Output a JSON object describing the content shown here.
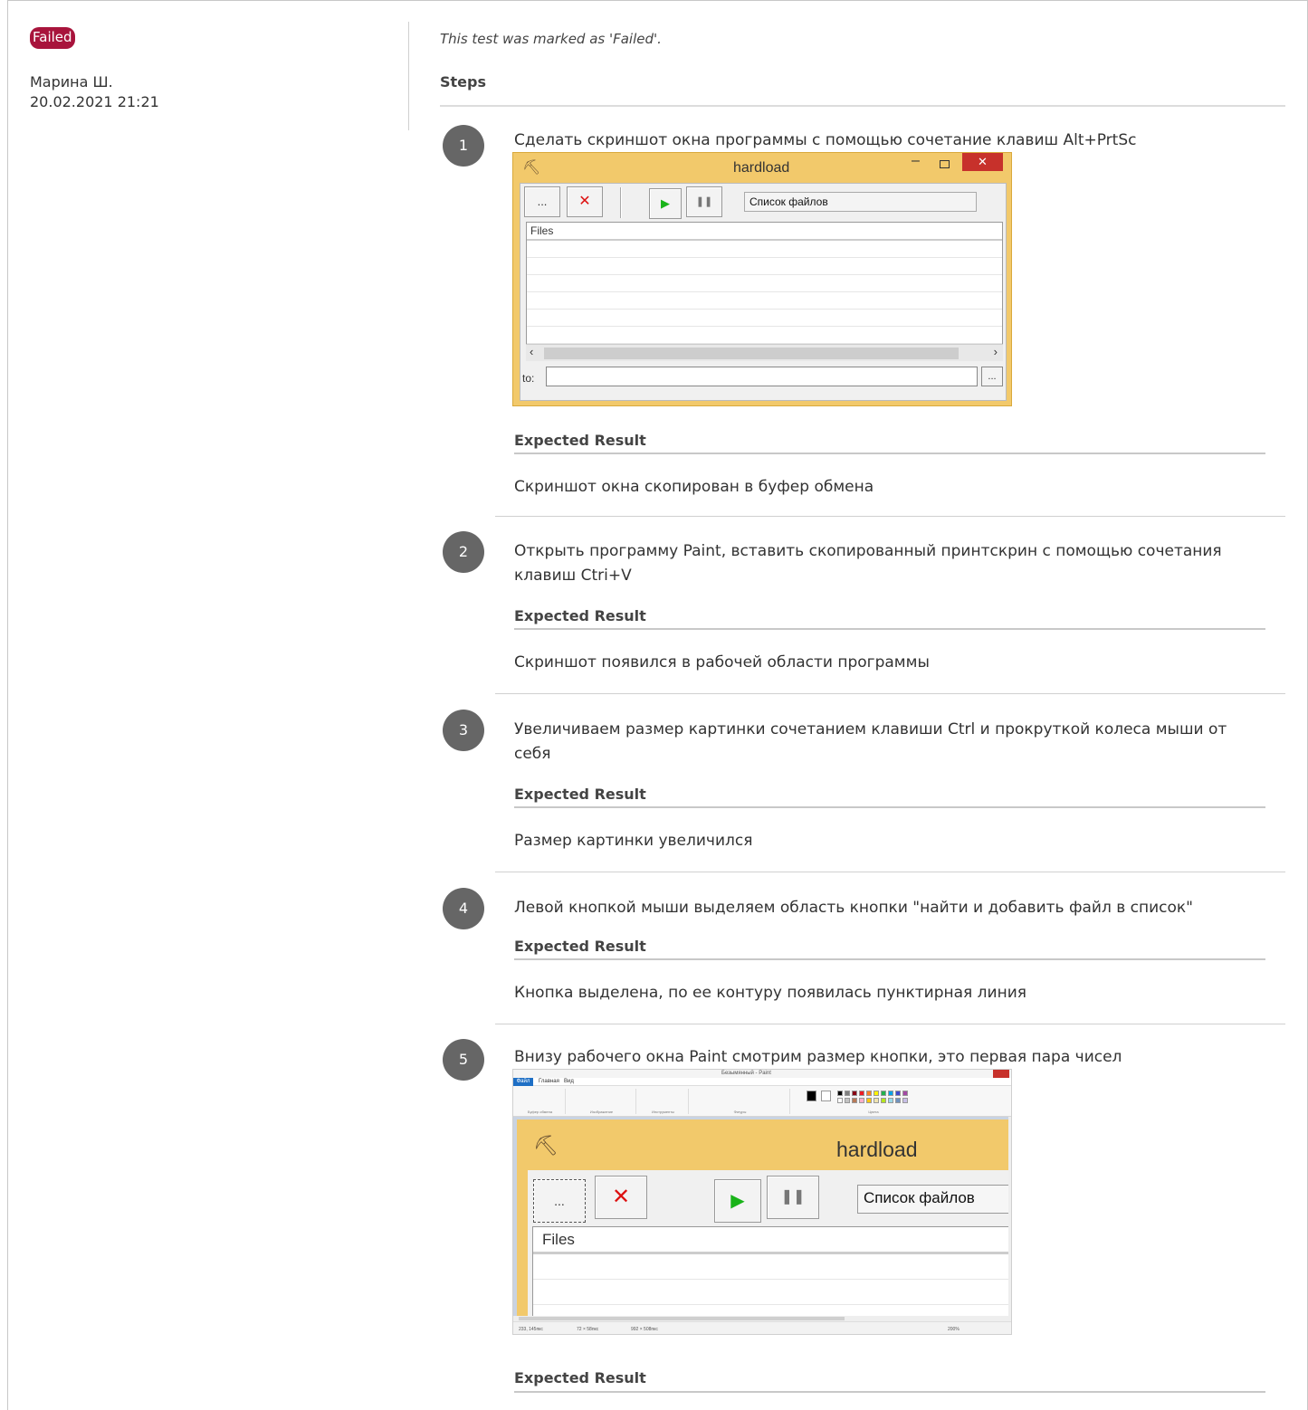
{
  "status_badge": "Failed",
  "author": "Марина Ш.",
  "timestamp": "20.02.2021 21:21",
  "marked_text": "This test was marked as 'Failed'.",
  "steps_heading": "Steps",
  "expected_label": "Expected Result",
  "steps": [
    {
      "number": "1",
      "text": "Сделать скриншот окна программы с помощью сочетание клавиш Alt+PrtSc",
      "expected": "Скриншот окна скопирован в буфер обмена"
    },
    {
      "number": "2",
      "text": "Открыть программу Paint, вставить скопированный принтскрин с помощью сочетания клавиш Ctri+V",
      "expected": "Скриншот появился в рабочей области программы"
    },
    {
      "number": "3",
      "text": "Увеличиваем размер картинки сочетанием клавиши Ctrl и прокруткой колеса мыши от себя",
      "expected": "Размер картинки увеличился"
    },
    {
      "number": "4",
      "text": "Левой кнопкой мыши выделяем область кнопки \"найти и добавить файл в список\"",
      "expected": "Кнопка выделена, по ее контуру появилась пунктирная линия"
    },
    {
      "number": "5",
      "text": "Внизу рабочего окна Paint смотрим размер кнопки, это первая пара чисел",
      "expected": ""
    }
  ],
  "hardload": {
    "title": "hardload",
    "browse_label": "...",
    "list_label": "Список файлов",
    "files_header": "Files",
    "to_label": "to:",
    "to_browse": "...",
    "close_glyph": "✕",
    "minimize_glyph": "–"
  },
  "paint": {
    "title": "Безымянный - Paint",
    "tab_file": "Файл",
    "tab_home": "Главная",
    "tab_view": "Вид",
    "group_clipboard": "Буфер обмена",
    "group_image": "Изображение",
    "group_tools": "Инструменты",
    "group_shapes": "Фигуры",
    "group_colors": "Цвета",
    "status_pos": "233, 145пкс",
    "status_sel": "72 × 58пкс",
    "status_size": "992 × 508пкс",
    "status_zoom": "200%"
  },
  "colors": {
    "badge": "#a8143c",
    "window_bg": "#f2c96b",
    "step_circle": "#666666"
  }
}
